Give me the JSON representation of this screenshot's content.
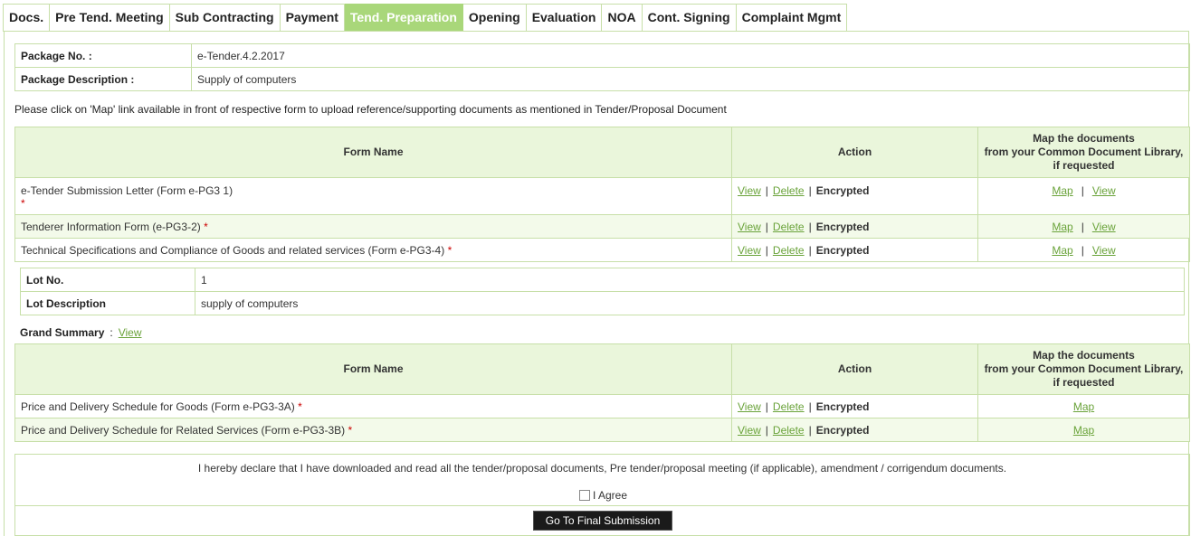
{
  "tabs": [
    {
      "label": "Docs."
    },
    {
      "label": "Pre Tend. Meeting"
    },
    {
      "label": "Sub Contracting"
    },
    {
      "label": "Payment"
    },
    {
      "label": "Tend. Preparation",
      "active": true
    },
    {
      "label": "Opening"
    },
    {
      "label": "Evaluation"
    },
    {
      "label": "NOA"
    },
    {
      "label": "Cont. Signing"
    },
    {
      "label": "Complaint Mgmt"
    }
  ],
  "package": {
    "no_label": "Package No. :",
    "no_value": "e-Tender.4.2.2017",
    "desc_label": "Package Description :",
    "desc_value": "Supply of computers"
  },
  "instruction": "Please click on 'Map' link available in front of respective form to upload reference/supporting documents as mentioned in Tender/Proposal Document",
  "table_headers": {
    "form_name": "Form Name",
    "action": "Action",
    "map_line1": "Map the documents",
    "map_line2": "from your Common Document Library,",
    "map_line3": "if requested"
  },
  "links": {
    "view": "View",
    "delete": "Delete",
    "encrypted": "Encrypted",
    "map": "Map",
    "sep": "|",
    "required": "*"
  },
  "forms": [
    {
      "name": "e-Tender Submission Letter (Form e-PG3 1)"
    },
    {
      "name": "Tenderer Information Form (e-PG3-2)"
    },
    {
      "name": "Technical Specifications and Compliance of Goods and related services (Form e-PG3-4)"
    }
  ],
  "lot": {
    "no_label": "Lot No.",
    "no_value": "1",
    "desc_label": "Lot Description",
    "desc_value": "supply of computers"
  },
  "grand_summary": {
    "label": "Grand Summary",
    "colon": ":",
    "link": "View"
  },
  "price_forms": [
    {
      "name": "Price and Delivery Schedule for Goods (Form e-PG3-3A)"
    },
    {
      "name": "Price and Delivery Schedule for Related Services (Form e-PG3-3B)"
    }
  ],
  "declaration": {
    "text": "I hereby declare that I have downloaded and read all the tender/proposal documents, Pre tender/proposal meeting (if applicable), amendment / corrigendum documents.",
    "agree_label": "I Agree",
    "agree_checked": false,
    "submit_label": "Go To Final Submission"
  },
  "colors": {
    "accent": "#a9d77a",
    "border": "#c7dfa8",
    "link": "#6aa33a",
    "header_bg": "#eaf6db",
    "required": "#cc0000"
  }
}
